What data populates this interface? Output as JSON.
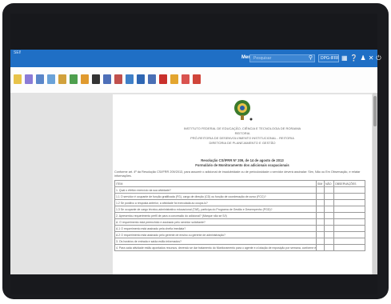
{
  "appbar": {
    "app_label": "SEI!",
    "menu_label": "Menu",
    "search_placeholder": "Pesquisar",
    "user_label": "DPG-IFRR",
    "icons": [
      "grid-icon",
      "info-icon",
      "user-icon",
      "close-icon",
      "power-icon"
    ]
  },
  "toolbar": {
    "icons": [
      {
        "name": "document-icon",
        "color": "#e8c34a"
      },
      {
        "name": "file-icon",
        "color": "#8b7bd6"
      },
      {
        "name": "view-icon",
        "color": "#5a86c9"
      },
      {
        "name": "edit-icon",
        "color": "#6aa2d8"
      },
      {
        "name": "attach-icon",
        "color": "#d1a13c"
      },
      {
        "name": "assign-icon",
        "color": "#4e9f4e"
      },
      {
        "name": "copy-icon",
        "color": "#e09a2e"
      },
      {
        "name": "pen-icon",
        "color": "#333333"
      },
      {
        "name": "sign-icon",
        "color": "#4d6fb8"
      },
      {
        "name": "block-icon",
        "color": "#c0504d"
      },
      {
        "name": "send-icon",
        "color": "#3f7fc7"
      },
      {
        "name": "save-icon",
        "color": "#2e66b3"
      },
      {
        "name": "print-icon",
        "color": "#4a6fb5"
      },
      {
        "name": "pdf-icon",
        "color": "#c9302c"
      },
      {
        "name": "comment-icon",
        "color": "#e3a52f"
      },
      {
        "name": "flag-icon",
        "color": "#d9534f"
      },
      {
        "name": "delete-icon",
        "color": "#d0453a"
      }
    ]
  },
  "document": {
    "header": [
      "INSTITUTO FEDERAL DE EDUCAÇÃO, CIÊNCIA E TECNOLOGIA DE RORAIMA",
      "REITORIA",
      "PRÓ-REITORIA DE DESENVOLVIMENTO INSTITUCIONAL - REITORIA",
      "DIRETORIA DE PLANEJAMENTO E GESTÃO"
    ],
    "caption_line1": "Resolução CS/IFRR Nº 209, de 14 de agosto de 2013",
    "caption_line2": "Formulário de Monitoramento dos adicionais ocupacionais",
    "intro": "Conforme art. 4º da Resolução CS/IFRR 209/2013, para assumir o adicional de insalubridade ou de periculosidade o servidor deverá assinalar: Sim, Não ou Em Observação, e relatar informações.",
    "table_headers": [
      "ITEM",
      "SIM",
      "NÃO",
      "OBSERVAÇÕES"
    ],
    "table_rows": [
      "1. Qual o efetivo exercício da sua atividade?",
      "1.1 O servidor é ocupante de função gratificada (FG), cargo de direção (CD) ou função de coordenação de curso (FCC)?",
      "1.2 Se positivo a resposta anterior, a atividade foi executada ao ocupá-lo?",
      "1.3 Se ocupante de cargo técnico-administrativo educacional (TAE), participa do Programa de Gestão e Desempenho (PGD)?",
      "2. Apresentou requerimento perfil de para a concessão do adicional? (Marque não se S/I)",
      "A. O requerimento está preenchido e assinado pelo servidor solicitante?",
      "A.1 O requerimento está assinado pela chefia imediata?",
      "A.2 O requerimento está assinado pelo gerente de ensino ou gerente de administração?",
      "3. Os horários de entrada e saída estão informados?",
      "4. Para cada atividade estão apontados recursos, devendo se dar tratamento do Monitoramento para o agente e a lotação de exposição por semana, conforme exercício no formulário?"
    ]
  }
}
